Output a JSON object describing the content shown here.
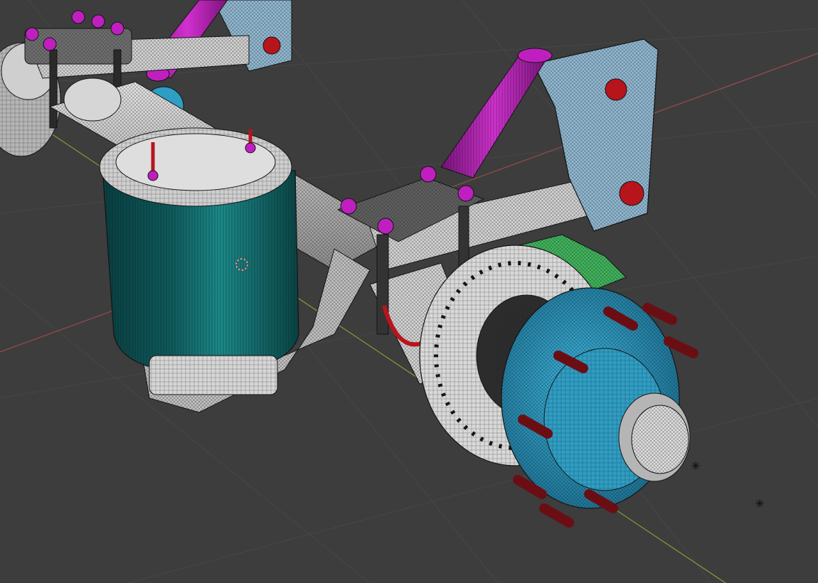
{
  "viewport": {
    "background": "#3d3d3d",
    "grid_color": "#494949",
    "x_axis_color": "#9a4a4e",
    "y_axis_color": "#8a9a3a",
    "wire_color": "#141414"
  },
  "scene": {
    "object_type": "truck-axle-suspension-wireframe",
    "materials": {
      "air_spring_bellow": "#0f5a5c",
      "air_spring_bellow_highlight": "#1b8a8a",
      "metal": "#cfcfcf",
      "metal_dark": "#8c8c8c",
      "hub": "#2e9ec4",
      "hub_dark": "#1a6f92",
      "bracket": "#8fb6cf",
      "shock_absorber": "#b71fb5",
      "bolt_caps": "#c01fc0",
      "studs": "#6b0e14",
      "red_accent": "#b8141c",
      "green_accent": "#3fb25a"
    }
  }
}
